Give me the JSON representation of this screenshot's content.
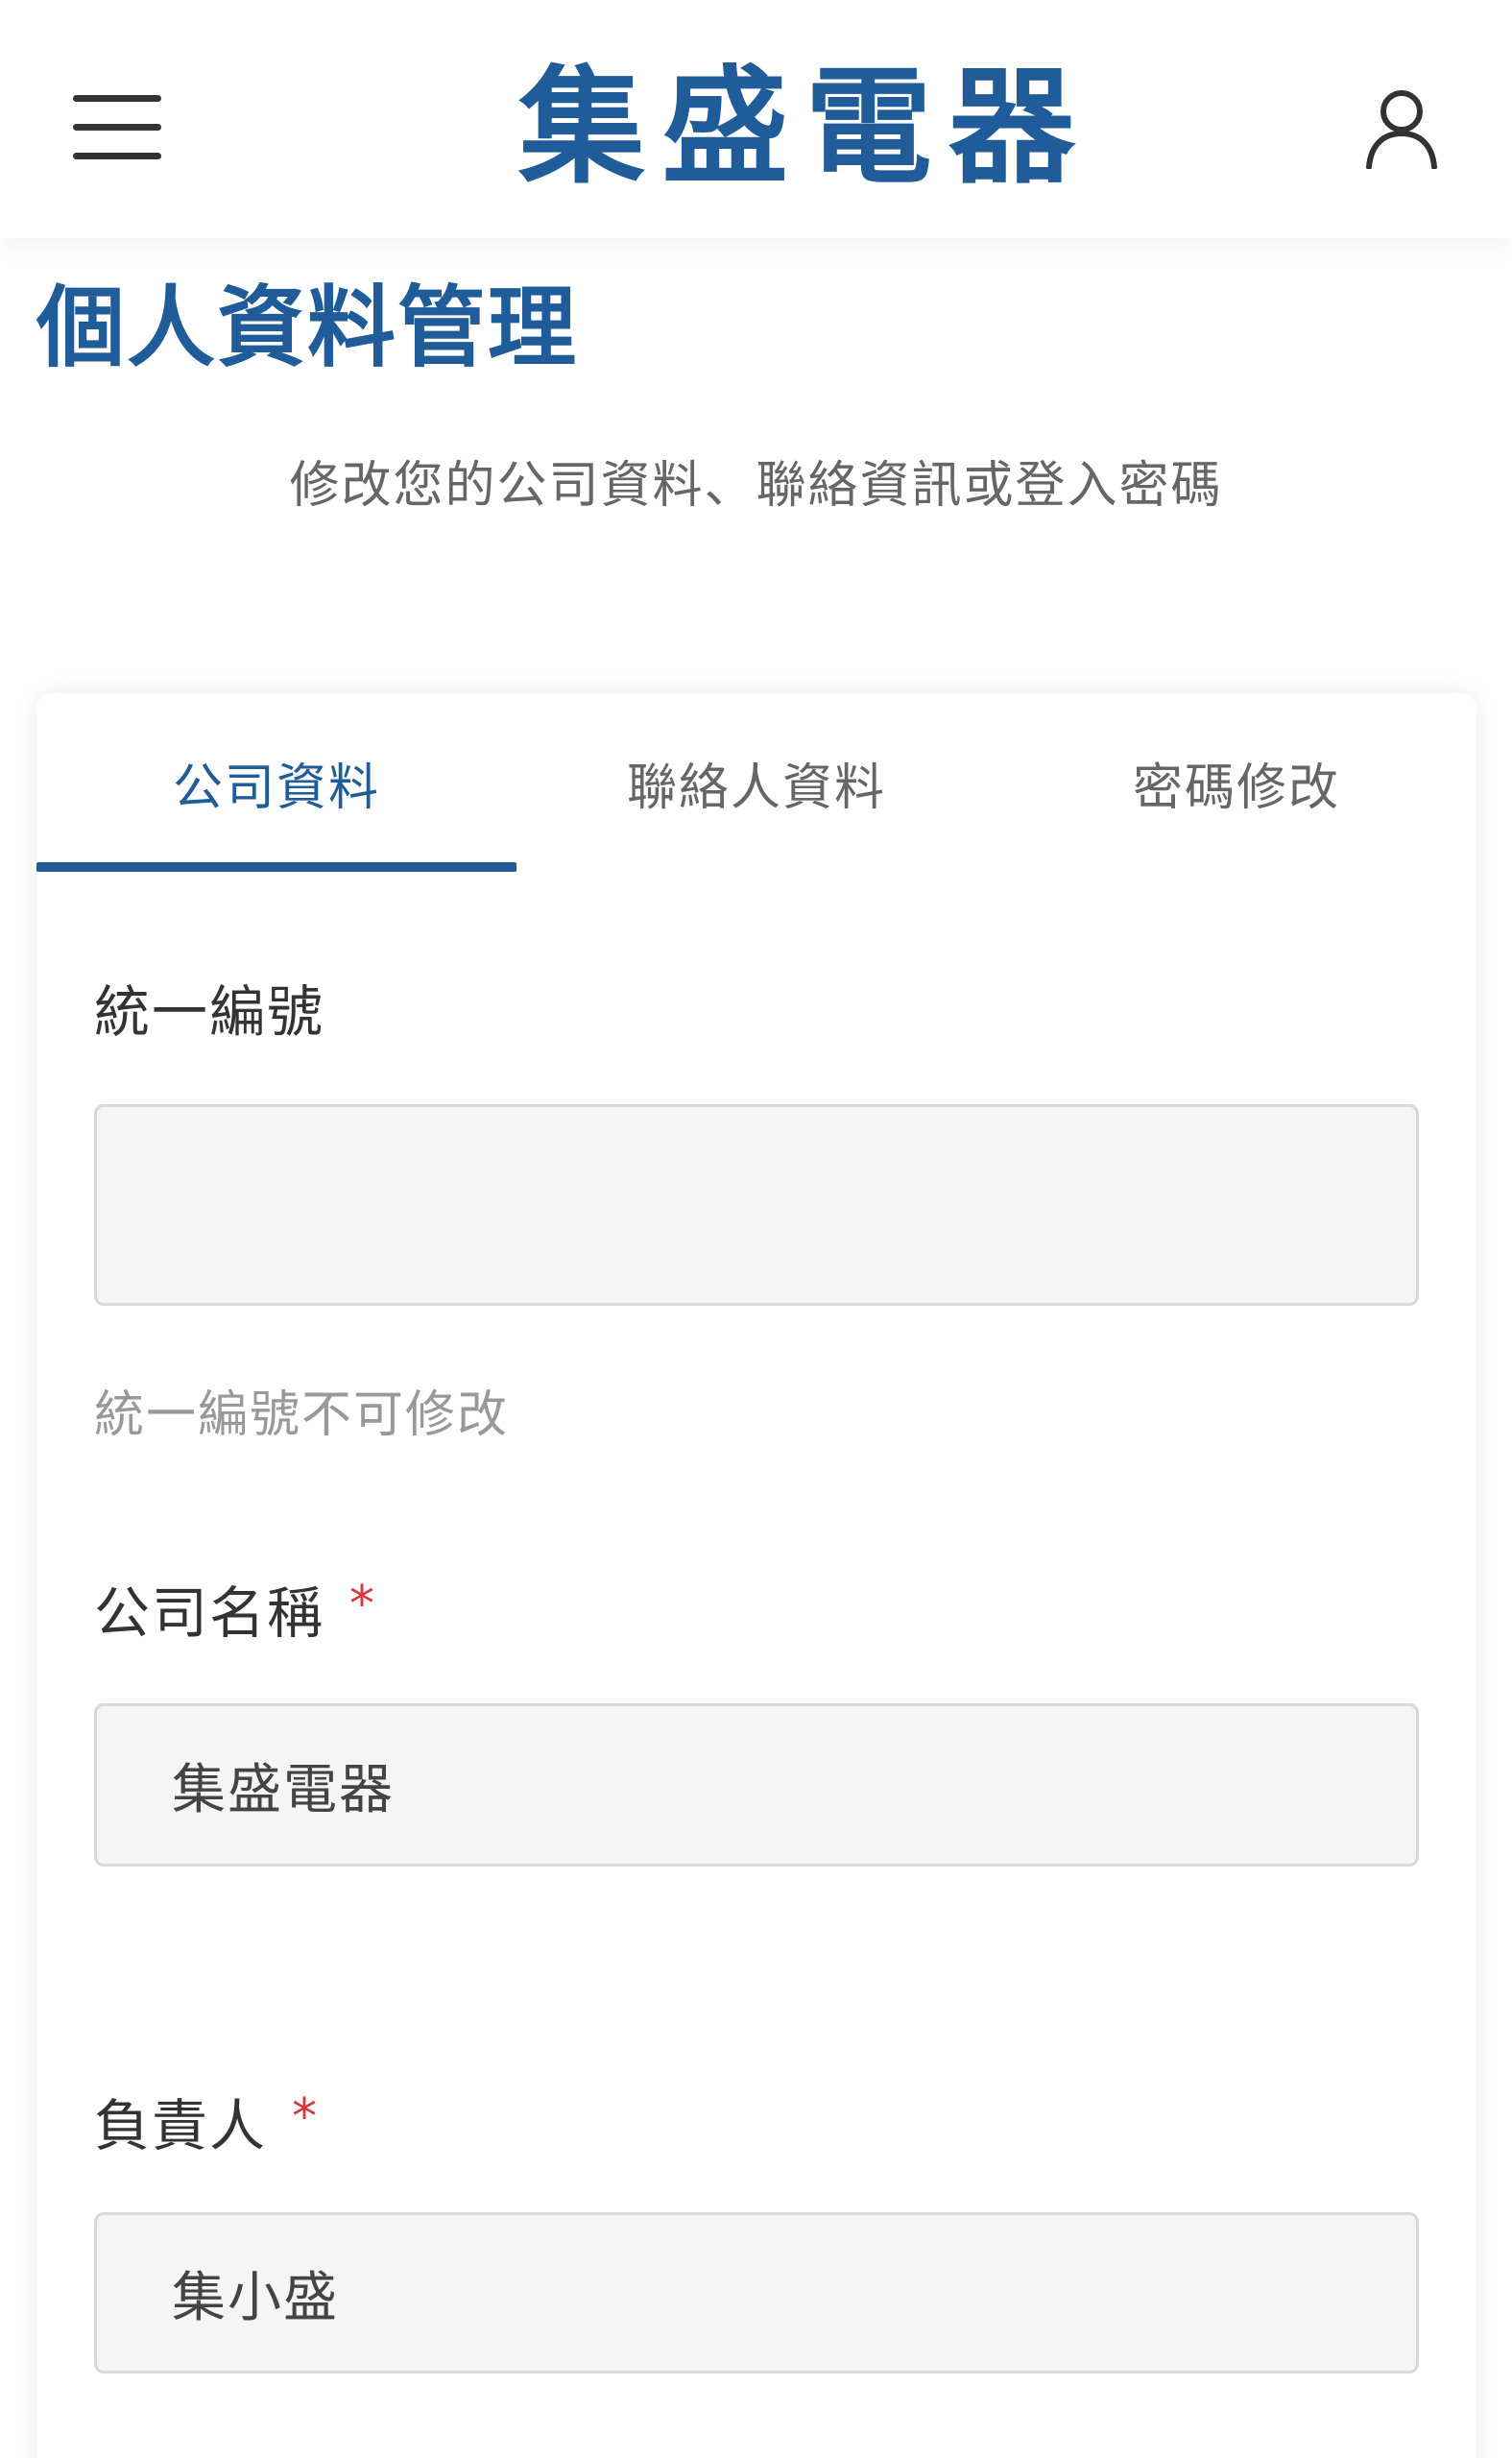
{
  "header": {
    "logo_chars": [
      "集",
      "盛",
      "電",
      "器"
    ],
    "icons": {
      "menu": "hamburger-menu-icon",
      "user": "user-account-icon"
    }
  },
  "page": {
    "title": "個人資料管理",
    "subtitle": "修改您的公司資料、聯絡資訊或登入密碼"
  },
  "tabs": [
    {
      "label": "公司資料",
      "active": true
    },
    {
      "label": "聯絡人資料",
      "active": false
    },
    {
      "label": "密碼修改",
      "active": false
    }
  ],
  "form": {
    "tax_id": {
      "label": "統一編號",
      "value": "",
      "hint": "統一編號不可修改",
      "editable": false
    },
    "company_name": {
      "label": "公司名稱",
      "required_mark": "*",
      "value": "集盛電器"
    },
    "owner": {
      "label": "負責人",
      "required_mark": "*",
      "value": "集小盛"
    }
  },
  "colors": {
    "brand": "#1f5c99",
    "required": "#d9363e",
    "text": "#333333",
    "muted": "#999999",
    "input_bg": "#f5f5f5",
    "input_border": "#d9d9d9"
  }
}
